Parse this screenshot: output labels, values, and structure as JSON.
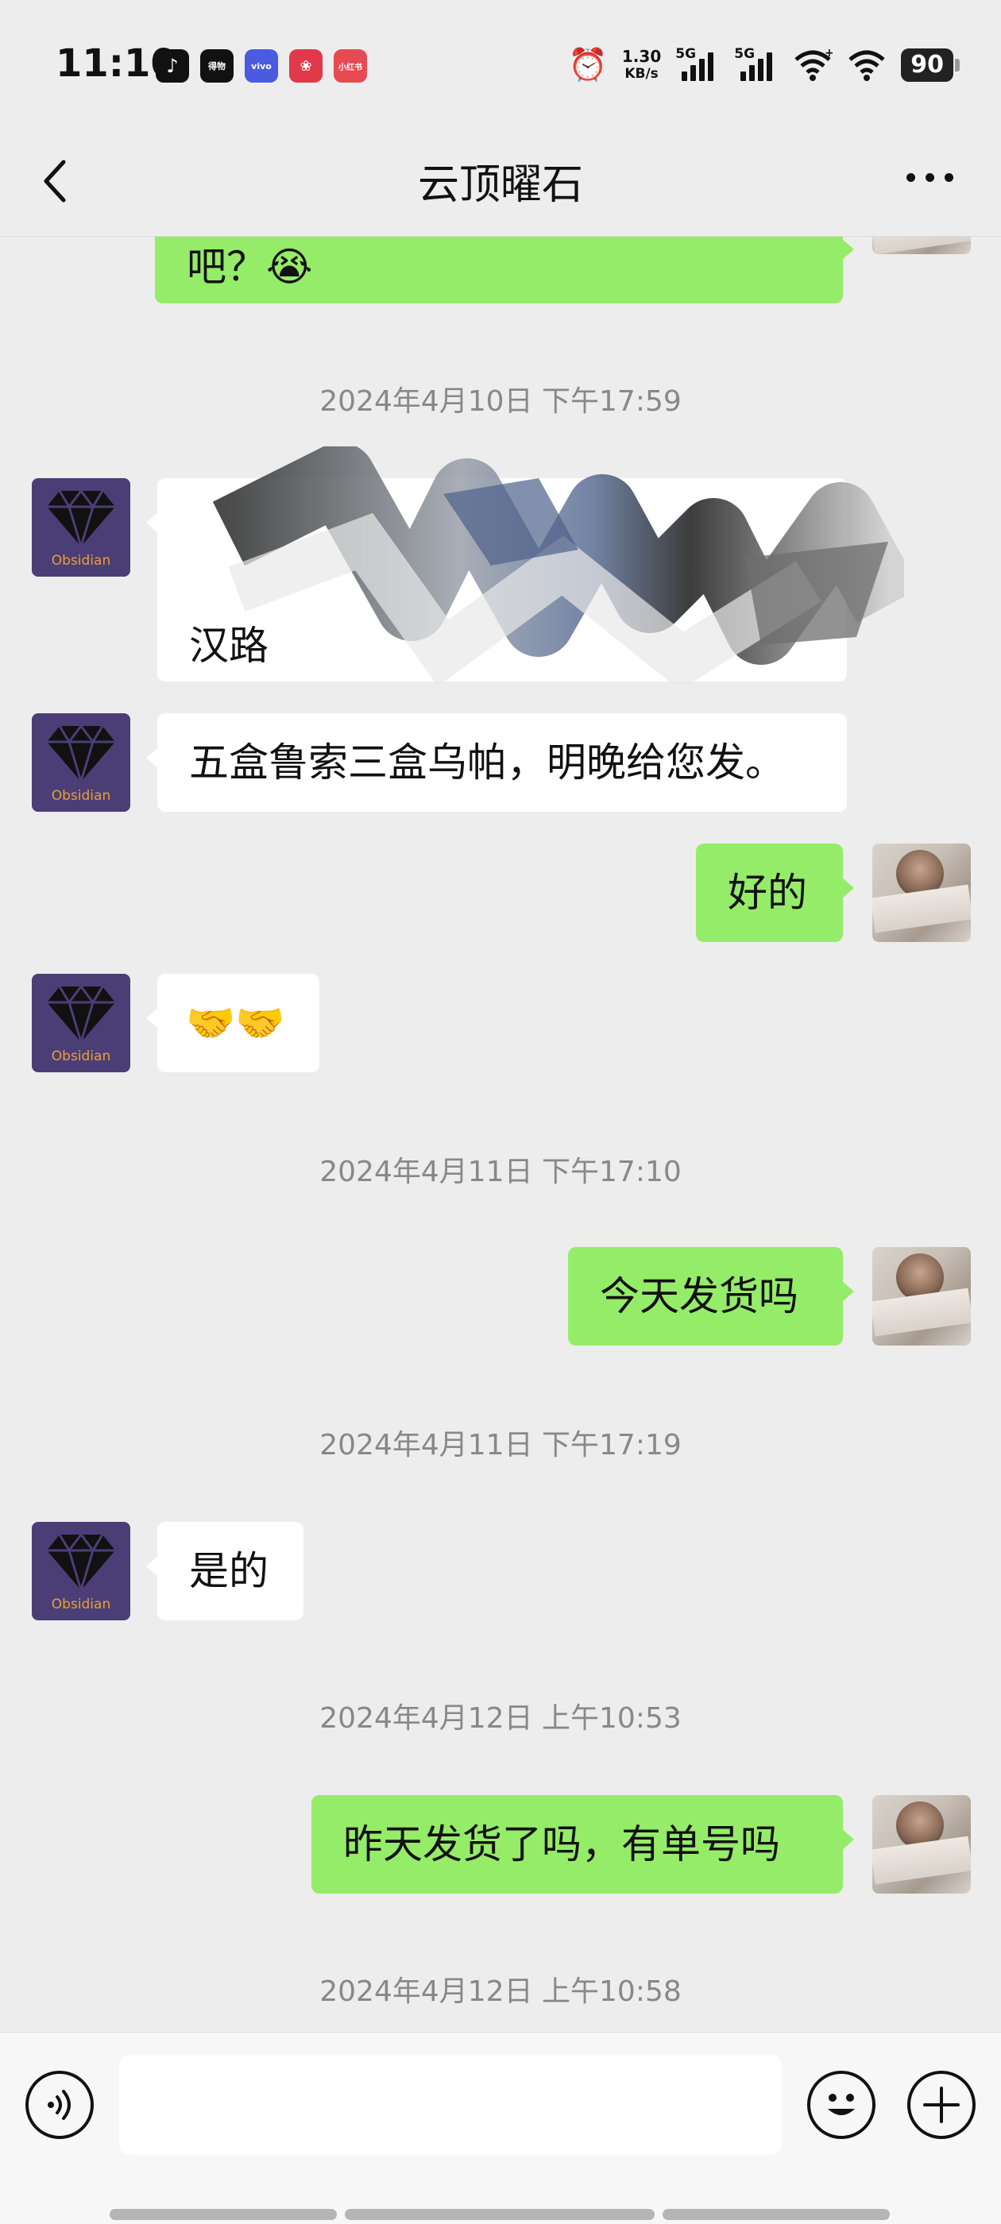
{
  "status_bar": {
    "time": "11:10",
    "apps": [
      {
        "name": "tiktok-icon",
        "glyph": "♪"
      },
      {
        "name": "dewu-icon",
        "glyph": "得物"
      },
      {
        "name": "vivo-icon",
        "glyph": "vivo"
      },
      {
        "name": "hongbao-icon",
        "glyph": "❀"
      },
      {
        "name": "xiaohongshu-icon",
        "glyph": "小红书"
      }
    ],
    "net_speed_value": "1.30",
    "net_speed_unit": "KB/s",
    "signal1_label": "5G",
    "signal2_label": "5G",
    "battery": "90"
  },
  "header": {
    "title": "云顶曜石"
  },
  "chat": {
    "partial_top_text": "吧？😭",
    "timestamps": [
      "2024年4月10日 下午17:59",
      "2024年4月11日 下午17:10",
      "2024年4月11日 下午17:19",
      "2024年4月12日 上午10:53",
      "2024年4月12日 上午10:58"
    ],
    "shop_avatar_label": "Obsidian",
    "messages": [
      {
        "from": "shop",
        "text": "汉路"
      },
      {
        "from": "shop",
        "text": "五盒鲁索三盒乌帕，明晚给您发。"
      },
      {
        "from": "me",
        "text": "好的"
      },
      {
        "from": "shop",
        "text": "🤝🤝"
      },
      {
        "from": "me",
        "text": "今天发货吗"
      },
      {
        "from": "shop",
        "text": "是的"
      },
      {
        "from": "me",
        "text": "昨天发货了吗，有单号吗"
      }
    ]
  },
  "colors": {
    "background": "#ededed",
    "outgoing_bubble": "#95ec69",
    "incoming_bubble": "#ffffff",
    "shop_avatar_bg": "#4b3e77",
    "shop_avatar_text": "#e7a030"
  },
  "input_bar": {
    "value": "",
    "voice_icon": "voice-icon",
    "emoji_icon": "emoji-icon",
    "plus_icon": "plus-icon"
  }
}
